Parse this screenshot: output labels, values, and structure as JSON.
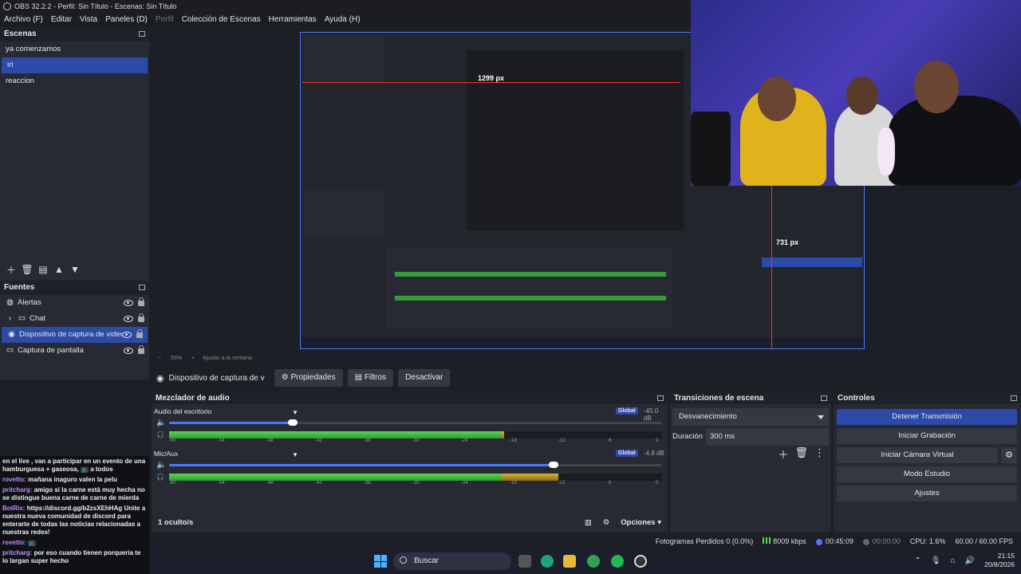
{
  "window": {
    "title": "OBS 32.2.2 - Perfil: Sin Título - Escenas: Sin Título"
  },
  "menu": [
    {
      "label": "Archivo (F)",
      "disabled": false
    },
    {
      "label": "Editar",
      "disabled": false
    },
    {
      "label": "Vista",
      "disabled": false
    },
    {
      "label": "Paneles (D)",
      "disabled": false
    },
    {
      "label": "Perfil",
      "disabled": true
    },
    {
      "label": "Colección de Escenas",
      "disabled": false
    },
    {
      "label": "Herramientas",
      "disabled": false
    },
    {
      "label": "Ayuda (H)",
      "disabled": false
    }
  ],
  "scenes": {
    "title": "Escenas",
    "items": [
      "ya comenzamos",
      "irl",
      "reaccion"
    ],
    "active_index": 1
  },
  "sources": {
    "title": "Fuentes",
    "items": [
      {
        "label": "Alertas",
        "icon": "globe-icon"
      },
      {
        "label": "Chat",
        "icon": "folder-icon"
      },
      {
        "label": "Dispositivo de captura de video",
        "icon": "camera-icon"
      },
      {
        "label": "Captura de pantalla",
        "icon": "monitor-icon"
      }
    ],
    "active_index": 2
  },
  "chat": [
    {
      "user": "",
      "text": "en el live , van a participar en un evento de una hamburguesa + gaseosa, 📺 a todos"
    },
    {
      "user": "rovetto:",
      "text": "mañana inaguro valen la pelu"
    },
    {
      "user": "pritcharg:",
      "text": "amigo si la carne está muy hecha no se distingue buena carne de carne de mierda"
    },
    {
      "user": "BotRix:",
      "text": "https://discord.gg/b2zsXEhHAg Unite a nuestra nueva comunidad de discord para enterarte de todas las noticias relacionadas a nuestras redes!"
    },
    {
      "user": "rovetto:",
      "text": "📺"
    },
    {
      "user": "pritcharg:",
      "text": "por eso cuando tienen porqueria te lo largan super hecho"
    }
  ],
  "preview": {
    "measure_width": "1299 px",
    "measure_height": "731 px"
  },
  "zoom": {
    "level": "55%",
    "fit_label": "Ajustar a la ventana"
  },
  "source_toolbar": {
    "selected_source": "Dispositivo de captura de v",
    "properties": "Propiedades",
    "filters": "Filtros",
    "deactivate": "Desactivar"
  },
  "mixer": {
    "title": "Mezclador de audio",
    "channels": [
      {
        "name": "Audio del escritorio",
        "global": "Global",
        "db": "-45.0 dB",
        "volume": 0.25,
        "level": 0.68
      },
      {
        "name": "Mic/Aux",
        "global": "Global",
        "db": "-4.8 dB",
        "volume": 0.78,
        "level": 0.79
      }
    ],
    "scale": [
      "-60",
      "-54",
      "-48",
      "-42",
      "-36",
      "-30",
      "-24",
      "-18",
      "-12",
      "-6",
      "0"
    ],
    "hidden_count": "1 oculto/s",
    "options": "Opciones"
  },
  "transitions": {
    "title": "Transiciones de escena",
    "selected": "Desvanecimiento",
    "duration_label": "Duración",
    "duration_value": "300 ms"
  },
  "controls": {
    "title": "Controles",
    "stop_stream": "Detener Transmisión",
    "start_recording": "Iniciar Grabación",
    "start_virtual_cam": "Iniciar Cámara Virtual",
    "studio_mode": "Modo Estudio",
    "settings": "Ajustes"
  },
  "status": {
    "dropped_frames": "Fotogramas Perdidos 0 (0.0%)",
    "bitrate": "8009 kbps",
    "stream_time": "00:45:09",
    "rec_time": "00:00:00",
    "cpu": "CPU: 1.6%",
    "fps": "60.00 / 60.00 FPS"
  },
  "taskbar": {
    "search": "Buscar",
    "time": "21:15",
    "date": "20/8/2026"
  },
  "colors": {
    "accent": "#2c4aa8",
    "panel": "#272a33",
    "background": "#1d1f26"
  }
}
